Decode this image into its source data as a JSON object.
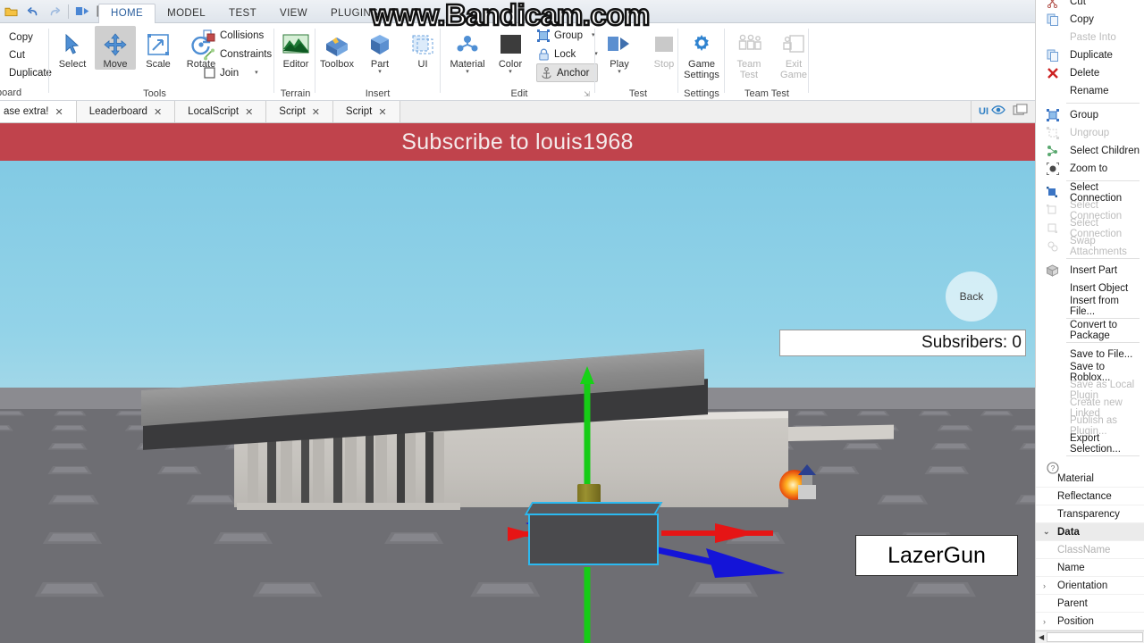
{
  "quick_access": {
    "buttons": [
      "open-icon",
      "undo-icon",
      "redo-icon",
      "play-solo-icon",
      "color-swatch-icon",
      "customize-caret-icon"
    ]
  },
  "ribbon": {
    "tabs": [
      {
        "label": "HOME",
        "active": true
      },
      {
        "label": "MODEL",
        "active": false
      },
      {
        "label": "TEST",
        "active": false
      },
      {
        "label": "VIEW",
        "active": false
      },
      {
        "label": "PLUGINS",
        "active": false
      }
    ],
    "groups": {
      "clipboard": {
        "label": "board",
        "items": [
          {
            "label": "Copy",
            "icon": "copy-icon"
          },
          {
            "label": "Cut",
            "icon": "cut-icon"
          },
          {
            "label": "Duplicate",
            "icon": "duplicate-icon"
          }
        ]
      },
      "tools": {
        "label": "Tools",
        "big": [
          {
            "label": "Select",
            "icon": "cursor-arrow-icon",
            "selected": false
          },
          {
            "label": "Move",
            "icon": "move-arrows-icon",
            "selected": true
          },
          {
            "label": "Scale",
            "icon": "scale-icon",
            "selected": false
          },
          {
            "label": "Rotate",
            "icon": "rotate-icon",
            "selected": false
          }
        ],
        "small": [
          {
            "label": "Collisions",
            "icon": "collisions-icon",
            "selected": false
          },
          {
            "label": "Constraints",
            "icon": "constraints-icon",
            "selected": false
          },
          {
            "label": "Join",
            "icon": "join-checkbox-icon",
            "selected": false,
            "caret": true
          }
        ]
      },
      "terrain": {
        "label": "Terrain",
        "big": [
          {
            "label": "Editor",
            "icon": "terrain-editor-icon"
          }
        ]
      },
      "insert": {
        "label": "Insert",
        "big": [
          {
            "label": "Toolbox",
            "icon": "toolbox-icon"
          },
          {
            "label": "Part",
            "icon": "part-cube-icon",
            "caret": true
          },
          {
            "label": "UI",
            "icon": "ui-frame-icon"
          }
        ]
      },
      "edit": {
        "label": "Edit",
        "big": [
          {
            "label": "Material",
            "icon": "material-icon",
            "caret": true
          },
          {
            "label": "Color",
            "icon": "color-swatch-icon",
            "caret": true
          }
        ],
        "small": [
          {
            "label": "Group",
            "icon": "group-icon",
            "caret": true,
            "selected": false
          },
          {
            "label": "Lock",
            "icon": "lock-icon",
            "caret": true,
            "selected": false
          },
          {
            "label": "Anchor",
            "icon": "anchor-icon",
            "selected": true
          }
        ]
      },
      "test": {
        "label": "Test",
        "big": [
          {
            "label": "Play",
            "icon": "play-icon",
            "caret": true,
            "disabled": false
          },
          {
            "label": "Stop",
            "icon": "stop-icon",
            "disabled": true
          }
        ]
      },
      "settings": {
        "label": "Settings",
        "big": [
          {
            "label": "Game\nSettings",
            "line1": "Game",
            "line2": "Settings",
            "icon": "gear-icon"
          }
        ]
      },
      "team_test": {
        "label": "Team Test",
        "big": [
          {
            "line1": "Team",
            "line2": "Test",
            "icon": "team-test-icon",
            "disabled": true
          },
          {
            "line1": "Exit",
            "line2": "Game",
            "icon": "exit-game-icon",
            "disabled": true
          }
        ]
      }
    }
  },
  "editor_tabs": [
    {
      "label": "ase extra!",
      "active": false
    },
    {
      "label": "Leaderboard",
      "active": false
    },
    {
      "label": "LocalScript",
      "active": false
    },
    {
      "label": "Script",
      "active": false
    },
    {
      "label": "Script",
      "active": false
    }
  ],
  "tabstrip_right": {
    "ui_toggle_label": "UI",
    "eye_icon": "eye-icon",
    "window_icon": "new-window-icon"
  },
  "viewport": {
    "banner_text": "Subscribe to louis1968",
    "subscribers_label": "Subsribers: 0",
    "lazergun_label": "LazerGun",
    "back_button_label": "Back",
    "watermark": "www.Bandicam.com",
    "selected_part": "LazerGun base part",
    "gizmo": "move-gizmo",
    "axis_colors": {
      "x": "#e61515",
      "y": "#16cc16",
      "z": "#1414d8"
    },
    "selection_outline_color": "#2bb9f0",
    "banner_color": "#c0434c",
    "sky_color": "#7ec8e3",
    "ground_color": "#6e6e73"
  },
  "context_menu": [
    {
      "label": "Cut",
      "icon": "cut-icon",
      "disabled": false,
      "clipped": true
    },
    {
      "label": "Copy",
      "icon": "copy-icon",
      "disabled": false
    },
    {
      "label": "Paste Into",
      "icon": "",
      "disabled": true
    },
    {
      "label": "Duplicate",
      "icon": "duplicate-icon",
      "disabled": false
    },
    {
      "label": "Delete",
      "icon": "delete-x-icon",
      "disabled": false
    },
    {
      "label": "Rename",
      "icon": "",
      "disabled": false
    },
    {
      "separator": true
    },
    {
      "label": "Group",
      "icon": "group-icon",
      "disabled": false
    },
    {
      "label": "Ungroup",
      "icon": "ungroup-icon",
      "disabled": true
    },
    {
      "label": "Select Children",
      "icon": "select-children-icon",
      "disabled": false
    },
    {
      "label": "Zoom to",
      "icon": "zoom-to-icon",
      "disabled": false
    },
    {
      "separator": true
    },
    {
      "label": "Select Connection",
      "icon": "select-connection-icon",
      "disabled": false
    },
    {
      "label": "Select Connection",
      "icon": "select-connection-icon",
      "disabled": true
    },
    {
      "label": "Select Connection",
      "icon": "select-connection-icon",
      "disabled": true
    },
    {
      "label": "Swap Attachments",
      "icon": "swap-attachments-icon",
      "disabled": true
    },
    {
      "separator": true
    },
    {
      "label": "Insert Part",
      "icon": "insert-part-icon",
      "disabled": false
    },
    {
      "label": "Insert Object",
      "icon": "",
      "disabled": false
    },
    {
      "label": "Insert from File...",
      "icon": "",
      "disabled": false
    },
    {
      "separator": true
    },
    {
      "label": "Convert to Package",
      "icon": "",
      "disabled": false
    },
    {
      "separator": true
    },
    {
      "label": "Save to File...",
      "icon": "",
      "disabled": false
    },
    {
      "label": "Save to Roblox...",
      "icon": "",
      "disabled": false
    },
    {
      "label": "Save as Local Plugin",
      "icon": "",
      "disabled": true
    },
    {
      "label": "Create new Linked",
      "icon": "",
      "disabled": true
    },
    {
      "label": "Publish as Plugin...",
      "icon": "",
      "disabled": true
    },
    {
      "label": "Export Selection...",
      "icon": "",
      "disabled": false
    },
    {
      "separator": true
    },
    {
      "label": "Help",
      "icon": "help-icon",
      "disabled": false
    }
  ],
  "properties": [
    {
      "label": "Material",
      "category": false,
      "disabled": false,
      "twisty": ""
    },
    {
      "label": "Reflectance",
      "category": false,
      "disabled": false,
      "twisty": ""
    },
    {
      "label": "Transparency",
      "category": false,
      "disabled": false,
      "twisty": ""
    },
    {
      "label": "Data",
      "category": true,
      "disabled": false,
      "twisty": "⌄"
    },
    {
      "label": "ClassName",
      "category": false,
      "disabled": true,
      "twisty": ""
    },
    {
      "label": "Name",
      "category": false,
      "disabled": false,
      "twisty": ""
    },
    {
      "label": "Orientation",
      "category": false,
      "disabled": false,
      "twisty": "›"
    },
    {
      "label": "Parent",
      "category": false,
      "disabled": false,
      "twisty": ""
    },
    {
      "label": "Position",
      "category": false,
      "disabled": false,
      "twisty": "›"
    }
  ]
}
